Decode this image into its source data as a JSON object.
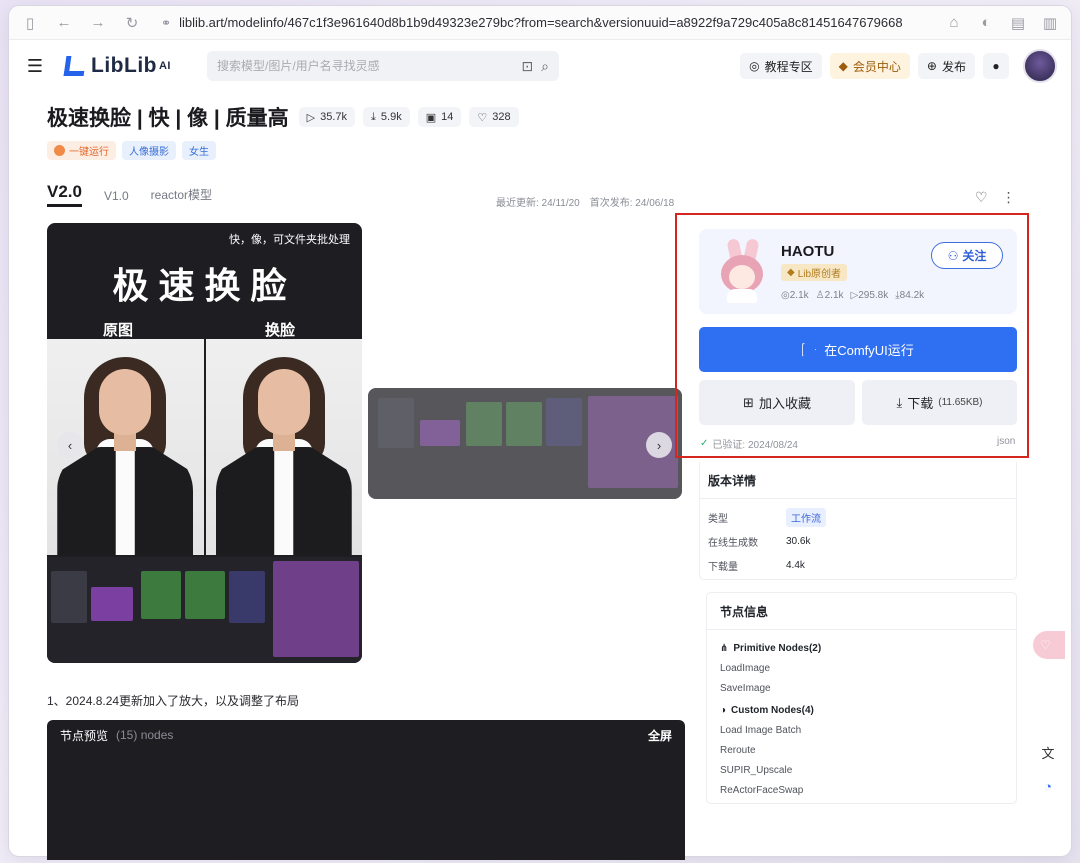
{
  "browser": {
    "url": "liblib.art/modelinfo/467c1f3e961640d8b1b9d49323e279bc?from=search&versionuuid=a8922f9a729c405a8c81451647679668"
  },
  "header": {
    "logo": "LibLib",
    "logo_sup": "AI",
    "search_placeholder": "搜索模型/图片/用户名寻找灵感",
    "tutorial": "教程专区",
    "vip": "会员中心",
    "publish": "发布"
  },
  "model": {
    "title": "极速换脸 | 快 | 像 | 质量高",
    "stats": {
      "runs": "35.7k",
      "downloads": "5.9k",
      "images": "14",
      "likes": "328"
    },
    "tags": [
      "一键运行",
      "人像摄影",
      "女生"
    ],
    "versions": [
      "V2.0",
      "V1.0",
      "reactor模型"
    ],
    "updated": "最近更新: 24/11/20",
    "published": "首次发布: 24/06/18"
  },
  "carousel": {
    "note": "快，像，可文件夹批处理",
    "headline": "极速换脸",
    "label_left": "原图",
    "label_right": "换脸"
  },
  "description": "1、2024.8.24更新加入了放大，以及调整了布局",
  "node_preview": {
    "title": "节点预览",
    "count": "(15) nodes",
    "fullscreen": "全屏"
  },
  "creator": {
    "name": "HAOTU",
    "badge": "Lib原创者",
    "follow": "关注",
    "stats": [
      "2.1k",
      "2.1k",
      "295.8k",
      "84.2k"
    ]
  },
  "actions": {
    "run": "在ComfyUI运行",
    "collect": "加入收藏",
    "download": "下载",
    "download_size": "(11.65KB)",
    "verified": "已验证: 2024/08/24",
    "format": "json"
  },
  "version_details": {
    "title": "版本详情",
    "rows": [
      {
        "key": "类型",
        "value": "工作流"
      },
      {
        "key": "在线生成数",
        "value": "30.6k"
      },
      {
        "key": "下载量",
        "value": "4.4k"
      }
    ]
  },
  "node_info": {
    "title": "节点信息",
    "groups": [
      {
        "name": "Primitive Nodes(2)",
        "items": [
          "LoadImage",
          "SaveImage"
        ]
      },
      {
        "name": "Custom Nodes(4)",
        "items": [
          "Load Image Batch",
          "Reroute",
          "SUPIR_Upscale",
          "ReActorFaceSwap"
        ]
      }
    ]
  },
  "colors": {
    "accent": "#2f6ff2",
    "highlight": "#d3261f",
    "vip": "#9b5d0b"
  }
}
